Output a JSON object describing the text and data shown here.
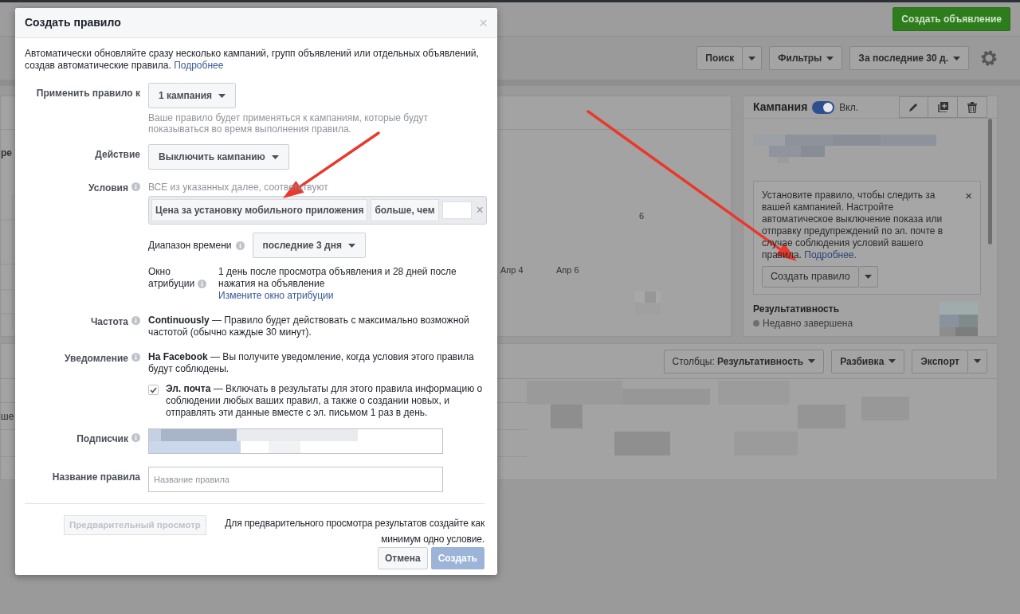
{
  "topbar": {
    "create_ad_button": "Создать объявление"
  },
  "toolbar": {
    "search_button": "Поиск",
    "filters_button": "Фильтры",
    "date_range_button": "За последние 30 д."
  },
  "chart_panel": {
    "cut_label": "ре",
    "value_label": "6",
    "axis_labels": [
      "Апр 4",
      "Апр 6"
    ]
  },
  "campaign_panel": {
    "title": "Кампания",
    "toggle": {
      "on": true,
      "label": "Вкл."
    },
    "tip": {
      "text": "Установите правило, чтобы следить за вашей кампанией. Настройте автоматическое выключение показа или отправку предупреждений по эл. почте в случае соблюдения условий вашего правила.",
      "link": "Подробнее.",
      "close": "×"
    },
    "create_rule_button": "Создать правило",
    "performance": {
      "title": "Результативность",
      "status": "Недавно завершена"
    }
  },
  "table_panel": {
    "cut_label": "ше",
    "columns_button": "Столбцы: **Результативность**",
    "breakdown_button": "Разбивка",
    "export_button": "Экспорт"
  },
  "dialog": {
    "title": "Создать правило",
    "close": "×",
    "intro": "Автоматически обновляйте сразу несколько кампаний, групп объявлений или отдельных объявлений, создав автоматические правила.",
    "intro_link": "Подробнее",
    "apply_to": {
      "label": "Применить правило к",
      "value": "1 кампания",
      "hint": "Ваше правило будет применяться к кампаниям, которые будут показываться во время выполнения правила."
    },
    "action": {
      "label": "Действие",
      "value": "Выключить кампанию"
    },
    "conditions": {
      "label": "Условия",
      "caption": "ВСЕ из указанных далее, соответствуют",
      "metric": "Цена за установку мобильного приложения",
      "operator": "больше, чем",
      "remove": "×",
      "time_range": {
        "label": "Диапазон времени",
        "value": "последние 3 дня"
      },
      "attribution": {
        "label": "Окно атрибуции",
        "text": "1 день после просмотра объявления и 28 дней после нажатия на объявление",
        "link": "Измените окно атрибуции"
      }
    },
    "frequency": {
      "label": "Частота",
      "text": "**Continuously** — Правило будет действовать с максимально возможной частотой (обычно каждые 30 минут)."
    },
    "notification": {
      "label": "Уведомление",
      "text": "**На Facebook** — Вы получите уведомление, когда условия этого правила будут соблюдены.",
      "email": {
        "checked": true,
        "text": "**Эл. почта** — Включать в результаты для этого правила информацию о соблюдении любых ваших правил, а также о создании новых, и отправлять эти данные вместе с эл. письмом 1 раз в день."
      }
    },
    "subscriber": {
      "label": "Подписчик"
    },
    "rule_name": {
      "label": "Название правила",
      "placeholder": "Название правила"
    },
    "preview": {
      "label": "Предварительный просмотр",
      "disabled": true,
      "note": "Для предварительного просмотра результатов создайте как минимум одно условие."
    },
    "buttons": [
      {
        "label": "Отмена",
        "kind": "secondary",
        "disabled": false
      },
      {
        "label": "Создать",
        "kind": "primary",
        "disabled": true
      }
    ]
  }
}
